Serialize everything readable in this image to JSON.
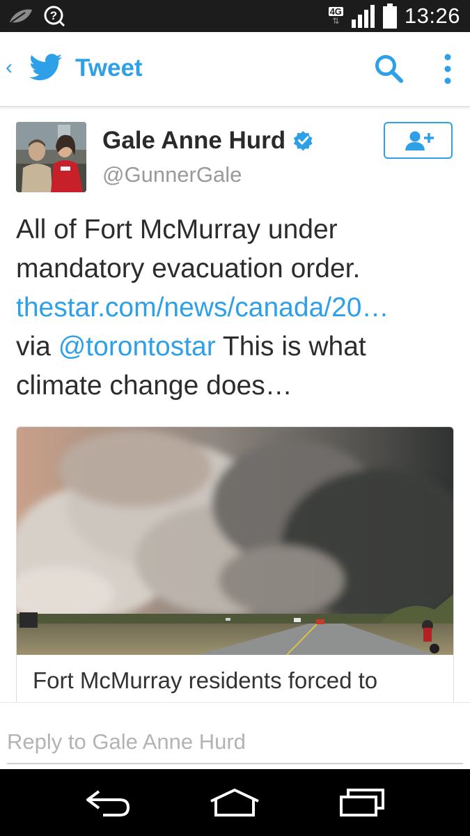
{
  "status_bar": {
    "time": "13:26",
    "network_type": "4G",
    "network_arrows": "⇅",
    "icons": [
      "leaf-icon",
      "help-circle-icon",
      "signal-icon",
      "battery-icon"
    ]
  },
  "app_bar": {
    "title": "Tweet",
    "back_glyph": "‹",
    "accent_color": "#2da0e8",
    "icons": [
      "twitter-bird-icon",
      "search-icon",
      "more-vertical-icon"
    ]
  },
  "tweet": {
    "author_name": "Gale Anne Hurd",
    "author_handle": "@GunnerGale",
    "verified": true,
    "text_line_1": "All of Fort McMurray under",
    "text_line_2": "mandatory evacuation order.",
    "link_url": "thestar.com/news/canada/20…",
    "via_text": "via",
    "mention": "@torontostar",
    "text_after_mention": "This is what",
    "text_line_5": "climate change does…",
    "follow_icon": "add-user-icon"
  },
  "card": {
    "title": "Fort McMurray residents forced to"
  },
  "reply": {
    "placeholder": "Reply to Gale Anne Hurd"
  },
  "nav_bar": {
    "icons": [
      "back-icon",
      "home-icon",
      "recent-apps-icon"
    ]
  }
}
